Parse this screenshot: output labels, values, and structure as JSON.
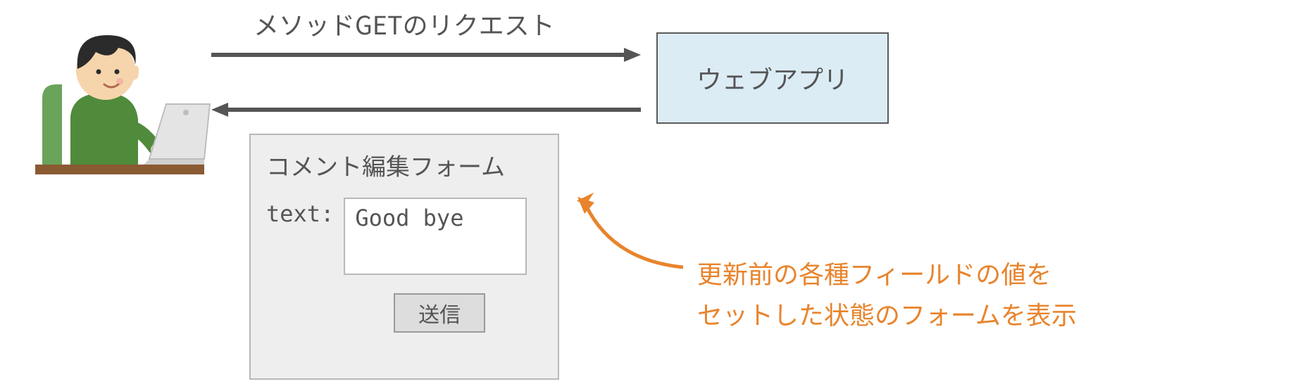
{
  "arrows": {
    "top_label": "メソッドGETのリクエスト"
  },
  "webapp": {
    "label": "ウェブアプリ"
  },
  "form": {
    "title": "コメント編集フォーム",
    "field_label": "text:",
    "field_value": "Good bye",
    "submit_label": "送信"
  },
  "annotation": {
    "line1": "更新前の各種フィールドの値を",
    "line2": "セットした状態のフォームを表示"
  },
  "colors": {
    "text": "#555555",
    "accent": "#e8842c",
    "webapp_bg": "#dcecf5",
    "form_bg": "#eeeeee"
  }
}
